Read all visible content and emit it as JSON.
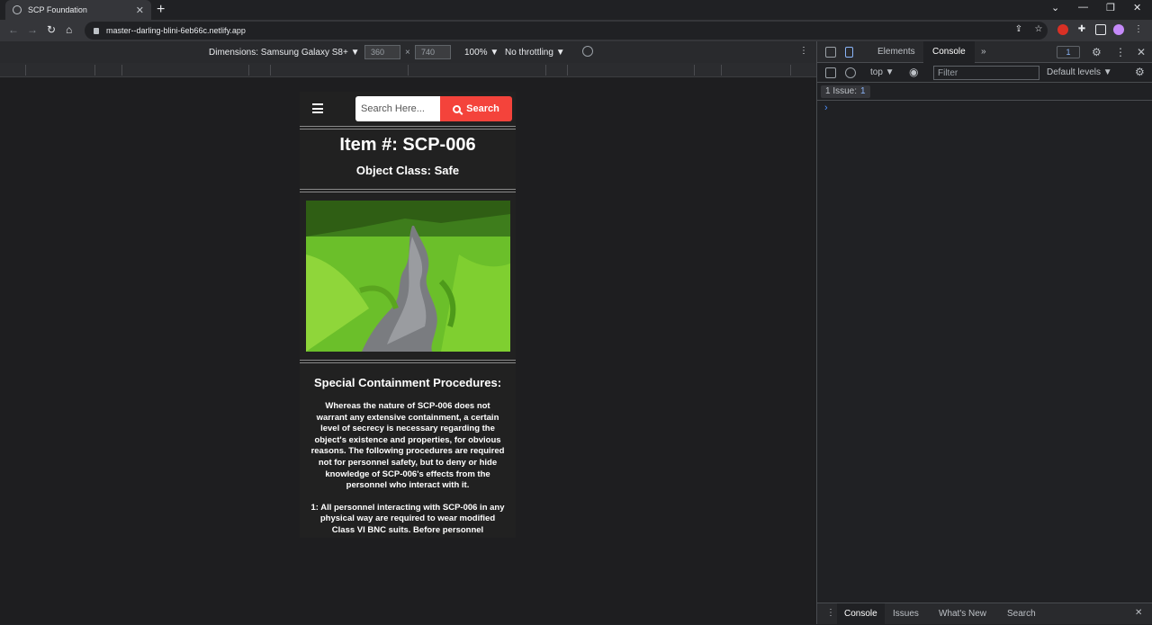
{
  "browser": {
    "tab_title": "SCP Foundation",
    "tab_close": "✕",
    "new_tab": "+",
    "url": "master--darling-blini-6eb66c.netlify.app",
    "window_controls": {
      "chevron": "⌄",
      "minimize": "—",
      "restore": "❐",
      "close": "✕"
    }
  },
  "device_toolbar": {
    "dimensions_label": "Dimensions: Samsung Galaxy S8+ ▼",
    "width": "360",
    "height": "740",
    "times": "×",
    "zoom": "100% ▼",
    "throttling": "No throttling ▼"
  },
  "page": {
    "search_placeholder": "Search Here...",
    "search_button": "Search",
    "item_title": "Item #: SCP-006",
    "object_class": "Object Class: Safe",
    "procedures_title": "Special Containment Procedures:",
    "procedures_p1": "Whereas the nature of SCP-006 does not warrant any extensive containment, a certain level of secrecy is necessary regarding the object's existence and properties, for obvious reasons. The following procedures are required not for personnel safety, but to deny or hide knowledge of SCP-006's effects from the personnel who interact with it.",
    "procedures_p2": "1: All personnel interacting with SCP-006 in any physical way are required to wear modified Class VI BNC suits. Before personnel"
  },
  "devtools": {
    "tabs": [
      "Elements",
      "Console"
    ],
    "active_tab": "Console",
    "more": "»",
    "messages_badge": "1",
    "context": "top ▼",
    "filter_placeholder": "Filter",
    "levels": "Default levels ▼",
    "issues_label": "1 Issue:",
    "issues_count": "1",
    "prompt": "›",
    "drawer_tabs": [
      "Console",
      "Issues",
      "What's New",
      "Search"
    ],
    "close": "✕"
  },
  "colors": {
    "search_button": "#f4433b",
    "page_bg": "#212121",
    "devtools_link": "#8ab4f8"
  }
}
